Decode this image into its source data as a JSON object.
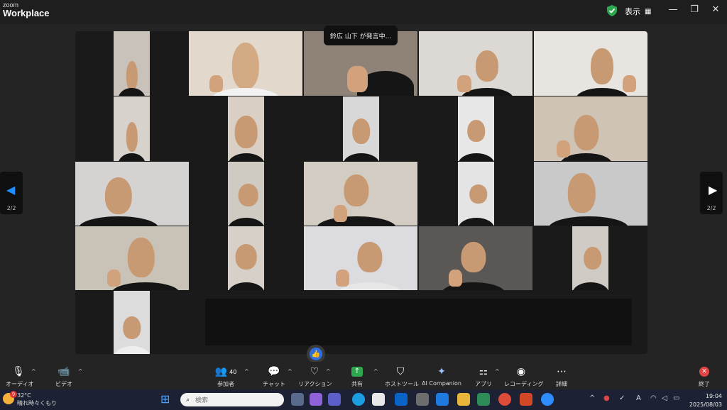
{
  "app": {
    "logo_top": "zoom",
    "logo_bottom": "Workplace",
    "view_label": "表示"
  },
  "window_controls": {
    "minimize": "—",
    "restore": "❐",
    "close": "✕"
  },
  "speaker_banner": "鈴広 山下 が発言中...",
  "pagination": {
    "left": "2/2",
    "right": "2/2"
  },
  "toolbar": {
    "audio": "オーディオ",
    "video": "ビデオ",
    "participants": "参加者",
    "participants_count": "40",
    "chat": "チャット",
    "reactions": "リアクション",
    "share": "共有",
    "host_tools": "ホストツール",
    "ai_companion": "AI Companion",
    "apps": "アプリ",
    "recording": "レコーディング",
    "more": "詳細",
    "end": "終了"
  },
  "taskbar": {
    "temperature": "32°C",
    "weather": "晴れ時々くもり",
    "weather_badge": "9",
    "search_placeholder": "検索",
    "tray_letter": "A",
    "time": "19:04",
    "date": "2025/08/03"
  },
  "colors": {
    "accent_green": "#2ea84f",
    "danger": "#e04545",
    "active_blue": "#1f8fff"
  }
}
